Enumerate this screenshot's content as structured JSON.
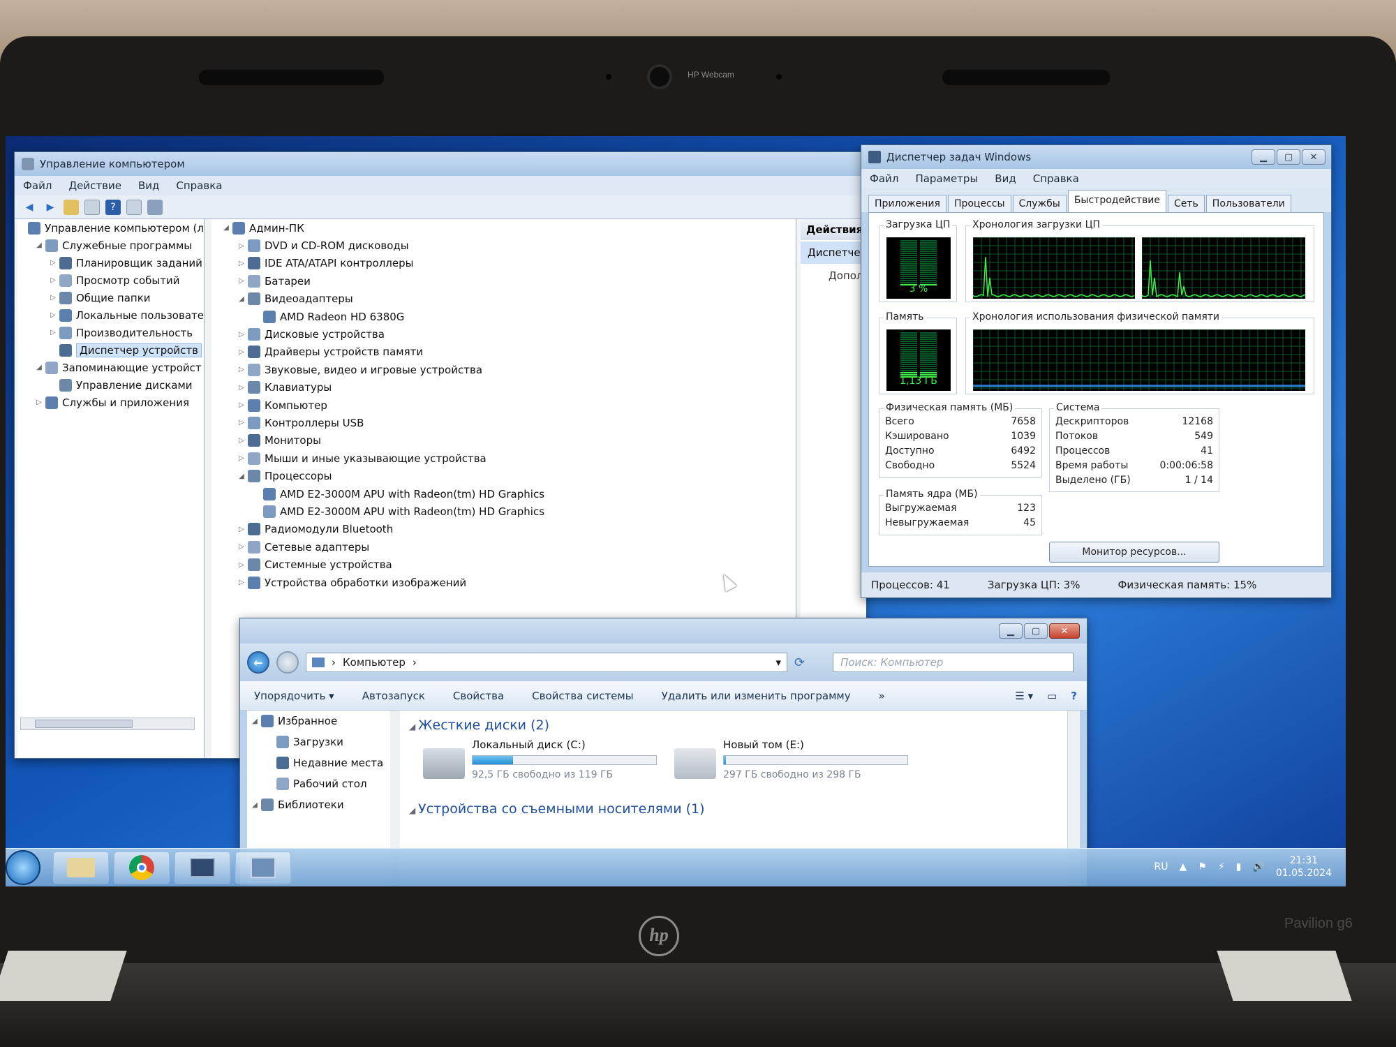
{
  "hardware": {
    "webcam_label": "HP Webcam",
    "brand": "hp",
    "model": "Pavilion g6"
  },
  "computer_management": {
    "title": "Управление компьютером",
    "menu": [
      "Файл",
      "Действие",
      "Вид",
      "Справка"
    ],
    "nav_tree": [
      {
        "label": "Управление компьютером (л",
        "level": 0,
        "expander": ""
      },
      {
        "label": "Служебные программы",
        "level": 1,
        "expander": "◢"
      },
      {
        "label": "Планировщик заданий",
        "level": 2,
        "expander": "▷"
      },
      {
        "label": "Просмотр событий",
        "level": 2,
        "expander": "▷"
      },
      {
        "label": "Общие папки",
        "level": 2,
        "expander": "▷"
      },
      {
        "label": "Локальные пользовате",
        "level": 2,
        "expander": "▷"
      },
      {
        "label": "Производительность",
        "level": 2,
        "expander": "▷"
      },
      {
        "label": "Диспетчер устройств",
        "level": 2,
        "expander": "",
        "selected": true
      },
      {
        "label": "Запоминающие устройст",
        "level": 1,
        "expander": "◢"
      },
      {
        "label": "Управление дисками",
        "level": 2,
        "expander": ""
      },
      {
        "label": "Службы и приложения",
        "level": 1,
        "expander": "▷"
      }
    ],
    "device_tree": [
      {
        "label": "Админ-ПК",
        "level": 0,
        "expander": "◢"
      },
      {
        "label": "DVD и CD-ROM дисководы",
        "level": 1,
        "expander": "▷"
      },
      {
        "label": "IDE ATA/ATAPI контроллеры",
        "level": 1,
        "expander": "▷"
      },
      {
        "label": "Батареи",
        "level": 1,
        "expander": "▷"
      },
      {
        "label": "Видеоадаптеры",
        "level": 1,
        "expander": "◢"
      },
      {
        "label": "AMD Radeon HD 6380G",
        "level": 2,
        "expander": ""
      },
      {
        "label": "Дисковые устройства",
        "level": 1,
        "expander": "▷"
      },
      {
        "label": "Драйверы устройств памяти",
        "level": 1,
        "expander": "▷"
      },
      {
        "label": "Звуковые, видео и игровые устройства",
        "level": 1,
        "expander": "▷"
      },
      {
        "label": "Клавиатуры",
        "level": 1,
        "expander": "▷"
      },
      {
        "label": "Компьютер",
        "level": 1,
        "expander": "▷"
      },
      {
        "label": "Контроллеры USB",
        "level": 1,
        "expander": "▷"
      },
      {
        "label": "Мониторы",
        "level": 1,
        "expander": "▷"
      },
      {
        "label": "Мыши и иные указывающие устройства",
        "level": 1,
        "expander": "▷"
      },
      {
        "label": "Процессоры",
        "level": 1,
        "expander": "◢"
      },
      {
        "label": "AMD E2-3000M APU with Radeon(tm) HD Graphics",
        "level": 2,
        "expander": ""
      },
      {
        "label": "AMD E2-3000M APU with Radeon(tm) HD Graphics",
        "level": 2,
        "expander": ""
      },
      {
        "label": "Радиомодули Bluetooth",
        "level": 1,
        "expander": "▷"
      },
      {
        "label": "Сетевые адаптеры",
        "level": 1,
        "expander": "▷"
      },
      {
        "label": "Системные устройства",
        "level": 1,
        "expander": "▷"
      },
      {
        "label": "Устройства обработки изображений",
        "level": 1,
        "expander": "▷"
      }
    ],
    "actions": {
      "header": "Действия",
      "item": "Диспетчер",
      "more": "Допол"
    }
  },
  "task_manager": {
    "title": "Диспетчер задач Windows",
    "menu": [
      "Файл",
      "Параметры",
      "Вид",
      "Справка"
    ],
    "tabs": [
      "Приложения",
      "Процессы",
      "Службы",
      "Быстродействие",
      "Сеть",
      "Пользователи"
    ],
    "active_tab": 3,
    "cpu_usage_label": "Загрузка ЦП",
    "cpu_usage_value": "3 %",
    "cpu_usage_fraction": 0.03,
    "cpu_history_label": "Хронология загрузки ЦП",
    "memory_label": "Память",
    "memory_value": "1,13 ГБ",
    "memory_fraction": 0.15,
    "memory_history_label": "Хронология использования физической памяти",
    "physical_memory": {
      "title": "Физическая память (МБ)",
      "rows": [
        {
          "k": "Всего",
          "v": "7658"
        },
        {
          "k": "Кэшировано",
          "v": "1039"
        },
        {
          "k": "Доступно",
          "v": "6492"
        },
        {
          "k": "Свободно",
          "v": "5524"
        }
      ]
    },
    "kernel_memory": {
      "title": "Память ядра (МБ)",
      "rows": [
        {
          "k": "Выгружаемая",
          "v": "123"
        },
        {
          "k": "Невыгружаемая",
          "v": "45"
        }
      ]
    },
    "system": {
      "title": "Система",
      "rows": [
        {
          "k": "Дескрипторов",
          "v": "12168"
        },
        {
          "k": "Потоков",
          "v": "549"
        },
        {
          "k": "Процессов",
          "v": "41"
        },
        {
          "k": "Время работы",
          "v": "0:00:06:58"
        },
        {
          "k": "Выделено (ГБ)",
          "v": "1 / 14"
        }
      ]
    },
    "resource_monitor_button": "Монитор ресурсов...",
    "status": {
      "processes": "Процессов: 41",
      "cpu": "Загрузка ЦП: 3%",
      "memory": "Физическая память: 15%"
    },
    "colors": {
      "graph_line": "#3ff04a",
      "graph_grid": "#0b5a2a",
      "memory_line": "#2c7fd8"
    }
  },
  "explorer": {
    "breadcrumb": "Компьютер",
    "search_placeholder": "Поиск: Компьютер",
    "commands": [
      "Упорядочить ▾",
      "Автозапуск",
      "Свойства",
      "Свойства системы",
      "Удалить или изменить программу",
      "»"
    ],
    "nav_tree": [
      {
        "label": "Избранное",
        "level": 0,
        "expander": "◢"
      },
      {
        "label": "Загрузки",
        "level": 1,
        "expander": ""
      },
      {
        "label": "Недавние места",
        "level": 1,
        "expander": ""
      },
      {
        "label": "Рабочий стол",
        "level": 1,
        "expander": ""
      },
      {
        "label": "Библиотеки",
        "level": 0,
        "expander": "◢"
      }
    ],
    "hard_disks_title": "Жесткие диски (2)",
    "removable_title": "Устройства со съемными носителями (1)",
    "disks": [
      {
        "name": "Локальный диск (C:)",
        "free": "92,5 ГБ свободно из 119 ГБ",
        "used_fraction": 0.22
      },
      {
        "name": "Новый том (E:)",
        "free": "297 ГБ свободно из 298 ГБ",
        "used_fraction": 0.01
      }
    ]
  },
  "taskbar": {
    "language": "RU",
    "time": "21:31",
    "date": "01.05.2024"
  }
}
